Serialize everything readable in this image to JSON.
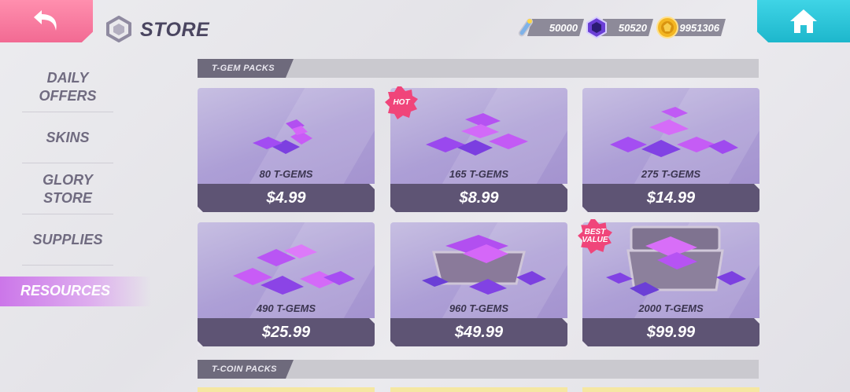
{
  "header": {
    "title": "STORE",
    "currencies": [
      {
        "icon": "key-icon",
        "value": "50000"
      },
      {
        "icon": "tgem-icon",
        "value": "50520"
      },
      {
        "icon": "tcoin-icon",
        "value": "9951306"
      }
    ]
  },
  "sidebar": {
    "items": [
      {
        "label_lines": [
          "DAILY",
          "OFFERS"
        ]
      },
      {
        "label_lines": [
          "SKINS"
        ]
      },
      {
        "label_lines": [
          "GLORY",
          "STORE"
        ]
      },
      {
        "label_lines": [
          "SUPPLIES"
        ]
      },
      {
        "label_lines": [
          "RESOURCES"
        ],
        "active": true
      }
    ]
  },
  "sections": {
    "tgem": {
      "title": "T-GEM PACKS"
    },
    "tcoin": {
      "title": "T-COIN PACKS"
    }
  },
  "packs": [
    {
      "amount": "80 T-GEMS",
      "price": "$4.99",
      "badge": ""
    },
    {
      "amount": "165 T-GEMS",
      "price": "$8.99",
      "badge": "HOT"
    },
    {
      "amount": "275 T-GEMS",
      "price": "$14.99",
      "badge": ""
    },
    {
      "amount": "490 T-GEMS",
      "price": "$25.99",
      "badge": ""
    },
    {
      "amount": "960 T-GEMS",
      "price": "$49.99",
      "badge": ""
    },
    {
      "amount": "2000 T-GEMS",
      "price": "$99.99",
      "badge_lines": [
        "BEST",
        "VALUE"
      ]
    }
  ],
  "colors": {
    "back_button": "#f26a93",
    "home_button": "#1db7cc",
    "badge": "#f0457a",
    "price_bar": "#5e5474",
    "active_tab": "#ca70e9"
  }
}
